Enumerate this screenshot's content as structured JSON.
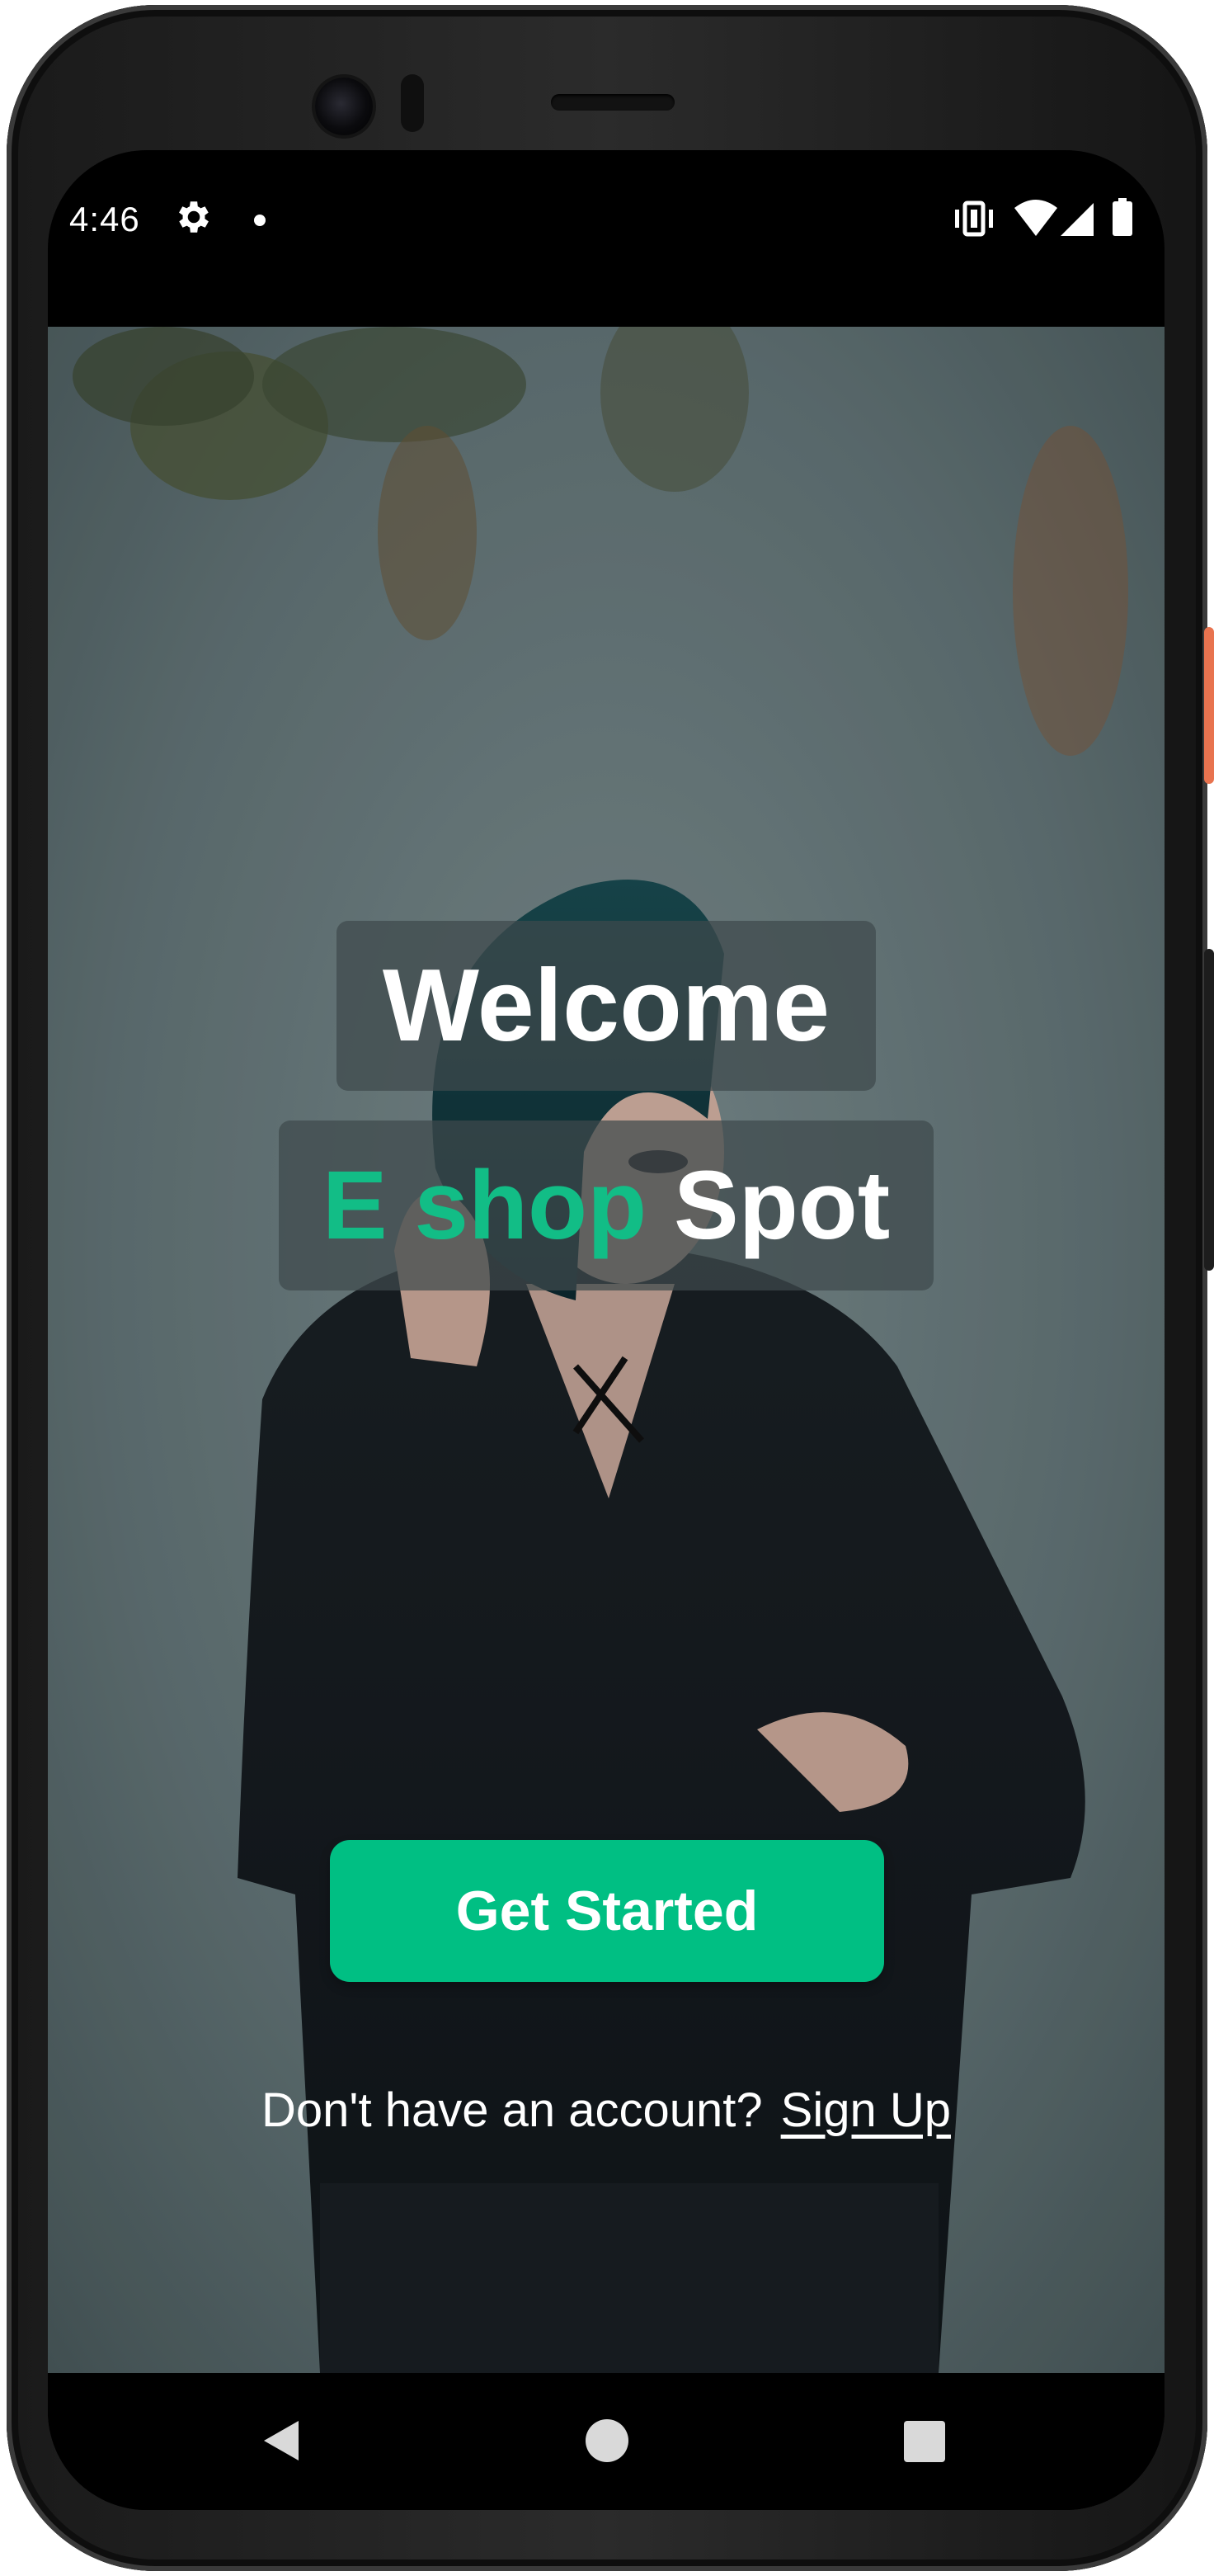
{
  "status_bar": {
    "time": "4:46",
    "icons": [
      "settings-icon",
      "notification-dot-icon",
      "vibrate-icon",
      "wifi-icon",
      "signal-icon",
      "battery-icon"
    ]
  },
  "welcome": {
    "title": "Welcome"
  },
  "brand": {
    "accent_text": "E shop",
    "rest_text": "Spot"
  },
  "cta": {
    "label": "Get Started"
  },
  "signup": {
    "prompt": "Don't have an account?",
    "link": "Sign Up"
  },
  "nav_bar": {
    "icons": [
      "back-icon",
      "home-icon",
      "recents-icon"
    ]
  },
  "colors": {
    "accent": "#00bf83",
    "pill_background": "#3e4a4c",
    "screen_background": "#000000"
  }
}
